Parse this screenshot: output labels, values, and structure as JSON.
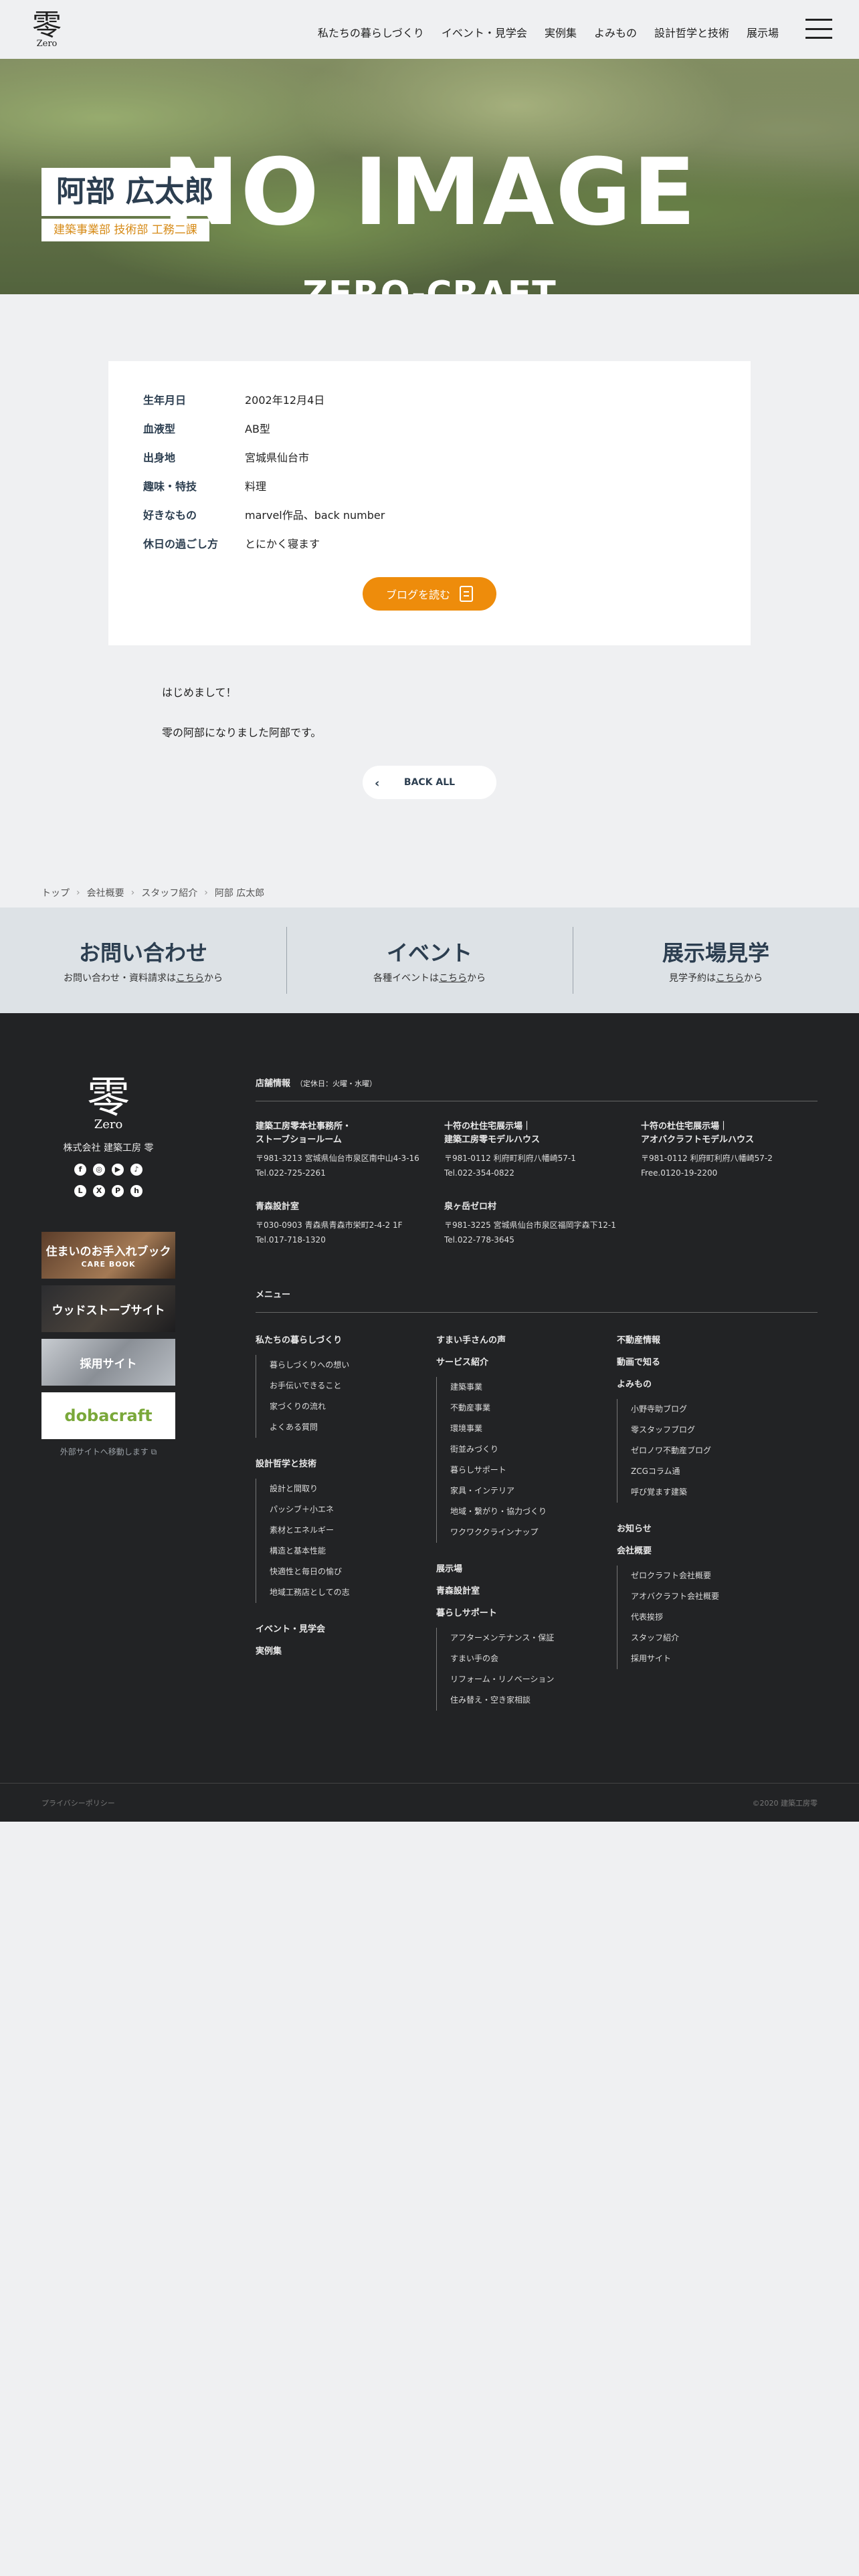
{
  "header": {
    "logo_kanji": "零",
    "logo_latin": "Zero",
    "nav": [
      "私たちの暮らしづくり",
      "イベント・見学会",
      "実例集",
      "よみもの",
      "設計哲学と技術",
      "展示場"
    ]
  },
  "hero": {
    "bg_text": "NO IMAGE",
    "brand": "ZERO-CRAFT",
    "name": "阿部 広太郎",
    "department": "建築事業部 技術部 工務二課"
  },
  "profile": {
    "rows": [
      {
        "label": "生年月日",
        "value": "2002年12月4日"
      },
      {
        "label": "血液型",
        "value": "AB型"
      },
      {
        "label": "出身地",
        "value": "宮城県仙台市"
      },
      {
        "label": "趣味・特技",
        "value": "料理"
      },
      {
        "label": "好きなもの",
        "value": "marvel作品、back number"
      },
      {
        "label": "休日の過ごし方",
        "value": "とにかく寝ます"
      }
    ],
    "blog_button": "ブログを読む"
  },
  "message": {
    "lines": [
      "はじめまして！",
      "零の阿部になりました阿部です。"
    ]
  },
  "back_button": "BACK ALL",
  "breadcrumb": [
    "トップ",
    "会社概要",
    "スタッフ紹介",
    "阿部 広太郎"
  ],
  "cta": [
    {
      "title": "お問い合わせ",
      "pre": "お問い合わせ・資料請求は",
      "link": "こちら",
      "post": "から"
    },
    {
      "title": "イベント",
      "pre": "各種イベントは",
      "link": "こちら",
      "post": "から"
    },
    {
      "title": "展示場見学",
      "pre": "見学予約は",
      "link": "こちら",
      "post": "から"
    }
  ],
  "footer": {
    "logo_kanji": "零",
    "logo_latin": "Zero",
    "company": "株式会社 建築工房 零",
    "socials": [
      "facebook-icon",
      "instagram-icon",
      "youtube-icon",
      "tiktok-icon",
      "line-icon",
      "x-icon",
      "pinterest-icon",
      "houzz-icon"
    ],
    "banners": [
      {
        "title": "住まいのお手入れブック",
        "sub": "CARE BOOK"
      },
      {
        "title": "ウッドストーブサイト",
        "sub": ""
      },
      {
        "title": "採用サイト",
        "sub": ""
      },
      {
        "title": "dobacraft",
        "sub": ""
      }
    ],
    "external_note": "外部サイトへ移動します",
    "stores_title": "店舗情報",
    "stores_note": "（定休日：火曜・水曜）",
    "stores": [
      {
        "name1": "建築工房零本社事務所・",
        "name2": "ストーブショールーム",
        "addr": "〒981-3213 宮城県仙台市泉区南中山4-3-16",
        "tel": "Tel.022-725-2261"
      },
      {
        "name1": "十符の杜住宅展示場｜",
        "name2": "建築工房零モデルハウス",
        "addr": "〒981-0112 利府町利府八幡崎57-1",
        "tel": "Tel.022-354-0822"
      },
      {
        "name1": "十符の杜住宅展示場｜",
        "name2": "アオバクラフトモデルハウス",
        "addr": "〒981-0112 利府町利府八幡崎57-2",
        "tel": "Free.0120-19-2200"
      },
      {
        "name1": "青森設計室",
        "name2": "",
        "addr": "〒030-0903 青森県青森市栄町2-4-2 1F",
        "tel": "Tel.017-718-1320"
      },
      {
        "name1": "泉ヶ岳ゼロ村",
        "name2": "",
        "addr": "〒981-3225 宮城県仙台市泉区福岡字森下12-1",
        "tel": "Tel.022-778-3645"
      }
    ],
    "menu_title": "メニュー",
    "menu": {
      "col1": [
        {
          "head": "私たちの暮らしづくり",
          "items": [
            "暮らしづくりへの想い",
            "お手伝いできること",
            "家づくりの流れ",
            "よくある質問"
          ]
        },
        {
          "head": "設計哲学と技術",
          "items": [
            "設計と間取り",
            "パッシブ＋小エネ",
            "素材とエネルギー",
            "構造と基本性能",
            "快適性と毎日の愉び",
            "地域工務店としての志"
          ]
        },
        {
          "head": "イベント・見学会",
          "items": []
        },
        {
          "head": "実例集",
          "items": []
        }
      ],
      "col2": [
        {
          "head": "すまい手さんの声",
          "items": []
        },
        {
          "head": "サービス紹介",
          "items": [
            "建築事業",
            "不動産事業",
            "環境事業",
            "街並みづくり",
            "暮らしサポート",
            "家具・インテリア",
            "地域・繋がり・協力づくり",
            "ワクワククラインナップ"
          ]
        },
        {
          "head": "展示場",
          "items": []
        },
        {
          "head": "青森設計室",
          "items": []
        },
        {
          "head": "暮らしサポート",
          "items": [
            "アフターメンテナンス・保証",
            "すまい手の会",
            "リフォーム・リノベーション",
            "住み替え・空き家相談"
          ]
        }
      ],
      "col3": [
        {
          "head": "不動産情報",
          "items": []
        },
        {
          "head": "動画で知る",
          "items": []
        },
        {
          "head": "よみもの",
          "items": [
            "小野寺助ブログ",
            "零スタッフブログ",
            "ゼロノワ不動産ブログ",
            "ZCGコラム通",
            "呼び覚ます建築"
          ]
        },
        {
          "head": "お知らせ",
          "items": []
        },
        {
          "head": "会社概要",
          "items": [
            "ゼロクラフト会社概要",
            "アオバクラフト会社概要",
            "代表挨拶",
            "スタッフ紹介",
            "採用サイト"
          ]
        }
      ]
    },
    "privacy": "プライバシーポリシー",
    "copyright": "©2020 建築工房零"
  }
}
